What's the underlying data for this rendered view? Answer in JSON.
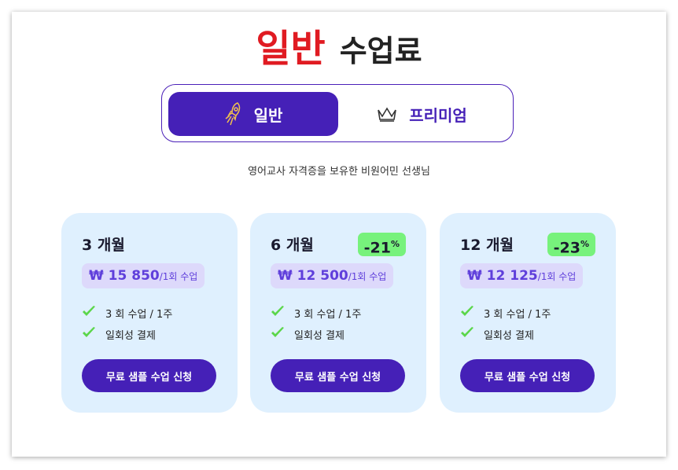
{
  "title": {
    "accent": "일반",
    "rest": "수업료"
  },
  "toggle": {
    "general_label": "일반",
    "premium_label": "프리미엄"
  },
  "subtitle": "영어교사 자격증을 보유한 비원어민 선생님",
  "plans": [
    {
      "period": "3 개월",
      "discount": "",
      "price": "₩ 15 850",
      "unit": "/1회 수업",
      "features": [
        "3 회 수업 / 1주",
        "일회성 결제"
      ],
      "cta": "무료 샘플 수업 신청"
    },
    {
      "period": "6 개월",
      "discount": "-21",
      "price": "₩ 12 500",
      "unit": "/1회 수업",
      "features": [
        "3 회 수업 / 1주",
        "일회성 결제"
      ],
      "cta": "무료 샘플 수업 신청"
    },
    {
      "period": "12 개월",
      "discount": "-23",
      "price": "₩ 12 125",
      "unit": "/1회 수업",
      "features": [
        "3 회 수업 / 1주",
        "일회성 결제"
      ],
      "cta": "무료 샘플 수업 신청"
    }
  ],
  "discount_suffix": "%",
  "icons": {
    "general": "rocket-icon",
    "premium": "crown-icon",
    "feature": "checkmark-icon"
  },
  "colors": {
    "accent": "#e01b22",
    "primary": "#4520b7",
    "card_bg": "#dff0fe",
    "discount_bg": "#77f27c",
    "price_text": "#5f3fdb"
  }
}
